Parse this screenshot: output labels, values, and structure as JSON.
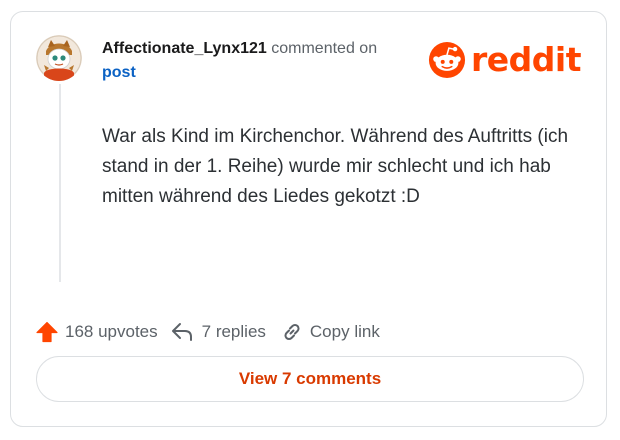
{
  "comment": {
    "username": "Affectionate_Lynx121",
    "action_text": "commented on",
    "post_link": "post",
    "body": "War als Kind im Kirchenchor. Während des Auftritts (ich stand in der 1. Reihe) wurde mir schlecht und ich hab mitten während des Liedes gekotzt :D"
  },
  "brand": {
    "logo_text": "reddit",
    "color": "#ff4500"
  },
  "actions": {
    "upvotes": "168 upvotes",
    "replies": "7 replies",
    "copy_link": "Copy link"
  },
  "footer": {
    "view_comments": "View 7 comments"
  },
  "icons": {
    "upvote": "upvote-arrow-icon",
    "reply": "reply-arrow-icon",
    "link": "chain-link-icon"
  },
  "colors": {
    "upvote": "#ff4500",
    "link": "#0b62c4",
    "button_text": "#d93a00",
    "border": "#dcdfe2"
  }
}
